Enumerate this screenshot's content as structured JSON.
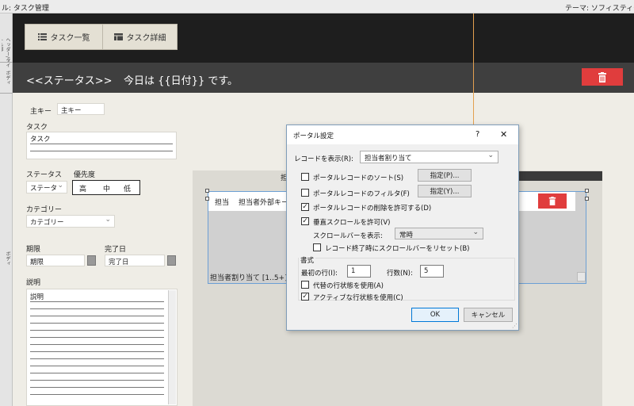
{
  "titlebar": {
    "left_title": "ル: タスク管理",
    "right_title": "テーマ: ソフィスティケーテ"
  },
  "left_strip": {
    "labels": [
      "ヘッダー/タイトル部",
      "ボディ",
      "ボディ"
    ]
  },
  "nav": {
    "task_list": "タスク一覧",
    "task_detail": "タスク詳細"
  },
  "status": {
    "title": "<<ステータス>>",
    "today": "今日は {{日付}} です。"
  },
  "form": {
    "primary_key_label": "主キー",
    "primary_key_value": "主キー",
    "task_label": "タスク",
    "task_value": "タスク",
    "status_label": "ステータス",
    "status_value": "ステータ",
    "priority_label": "優先度",
    "priority_options": [
      "高",
      "中",
      "低"
    ],
    "category_label": "カテゴリー",
    "category_value": "カテゴリー",
    "due_label": "期限",
    "due_value": "期限",
    "done_label": "完了日",
    "done_value": "完了日",
    "desc_label": "説明",
    "desc_value": "説明"
  },
  "portal": {
    "header_text": "担",
    "row_field1": "担当",
    "row_field2": "担当者外部キー",
    "footer": "担当者割り当て [1..5+]"
  },
  "dialog": {
    "title": "ポータル設定",
    "help": "?",
    "close": "✕",
    "show_records_label": "レコードを表示(R):",
    "show_records_value": "担当者割り当て",
    "sort_label": "ポータルレコードのソート(S)",
    "sort_checked": false,
    "sort_button": "指定(P)...",
    "filter_label": "ポータルレコードのフィルタ(F)",
    "filter_checked": false,
    "filter_button": "指定(Y)...",
    "allow_delete_label": "ポータルレコードの削除を許可する(D)",
    "allow_delete_checked": true,
    "allow_scroll_label": "垂直スクロールを許可(V)",
    "allow_scroll_checked": true,
    "scrollbar_label": "スクロールバーを表示:",
    "scrollbar_value": "常時",
    "reset_scroll_label": "レコード終了時にスクロールバーをリセット(B)",
    "reset_scroll_checked": false,
    "format_group": "書式",
    "first_row_label": "最初の行(I):",
    "first_row_value": "1",
    "rows_label": "行数(N):",
    "rows_value": "5",
    "alt_state_label": "代替の行状態を使用(A)",
    "alt_state_checked": false,
    "active_state_label": "アクティブな行状態を使用(C)",
    "active_state_checked": true,
    "ok": "OK",
    "cancel": "キャンセル"
  },
  "colors": {
    "accent_red": "#e03d3d",
    "header_dark": "#1e1e1e",
    "status_bar": "#3f3f3f",
    "guide_orange": "#e3a050",
    "dialog_focus": "#0078d7"
  }
}
